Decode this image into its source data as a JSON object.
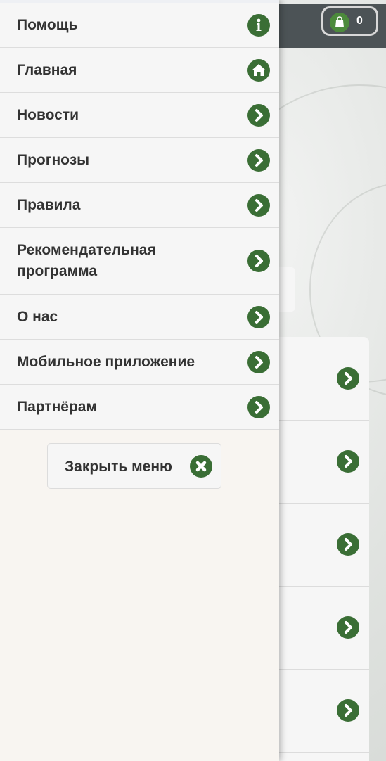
{
  "cart": {
    "count": "0",
    "icon": "shopping-bag-icon"
  },
  "menu": {
    "items": [
      {
        "label": "Помощь",
        "icon": "info-icon"
      },
      {
        "label": "Главная",
        "icon": "home-icon"
      },
      {
        "label": "Новости",
        "icon": "chevron-right-icon"
      },
      {
        "label": "Прогнозы",
        "icon": "chevron-right-icon"
      },
      {
        "label": "Правила",
        "icon": "chevron-right-icon"
      },
      {
        "label": "Рекомендательная программа",
        "icon": "chevron-right-icon"
      },
      {
        "label": "О нас",
        "icon": "chevron-right-icon"
      },
      {
        "label": "Мобильное приложение",
        "icon": "chevron-right-icon"
      },
      {
        "label": "Партнёрам",
        "icon": "chevron-right-icon"
      }
    ],
    "close_label": "Закрыть меню",
    "close_icon": "close-circle-icon"
  },
  "colors": {
    "accent": "#3a6e35",
    "header": "#4c5356",
    "drawer_bg": "#f8f5f1"
  }
}
